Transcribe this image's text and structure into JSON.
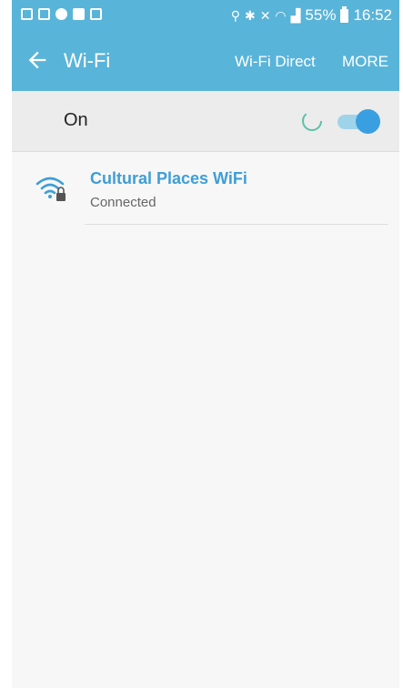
{
  "statusbar": {
    "left_icons": [
      "gallery-icon",
      "download-icon",
      "messenger-icon",
      "facebook-icon",
      "instagram-icon"
    ],
    "right_icons": [
      "location-icon",
      "bluetooth-icon",
      "mute-icon",
      "wifi-signal-icon",
      "cell-signal-icon"
    ],
    "battery": "55%",
    "time": "16:52"
  },
  "appbar": {
    "title": "Wi-Fi",
    "wifi_direct": "Wi-Fi Direct",
    "more": "MORE"
  },
  "switch": {
    "label": "On",
    "state": true
  },
  "networks": [
    {
      "name": "Cultural Places WiFi",
      "status": "Connected",
      "icon": "wifi-lock-icon"
    }
  ],
  "colors": {
    "primary": "#59b4d9",
    "accent": "#3a9fe0",
    "network_name": "#3f9ed6"
  }
}
